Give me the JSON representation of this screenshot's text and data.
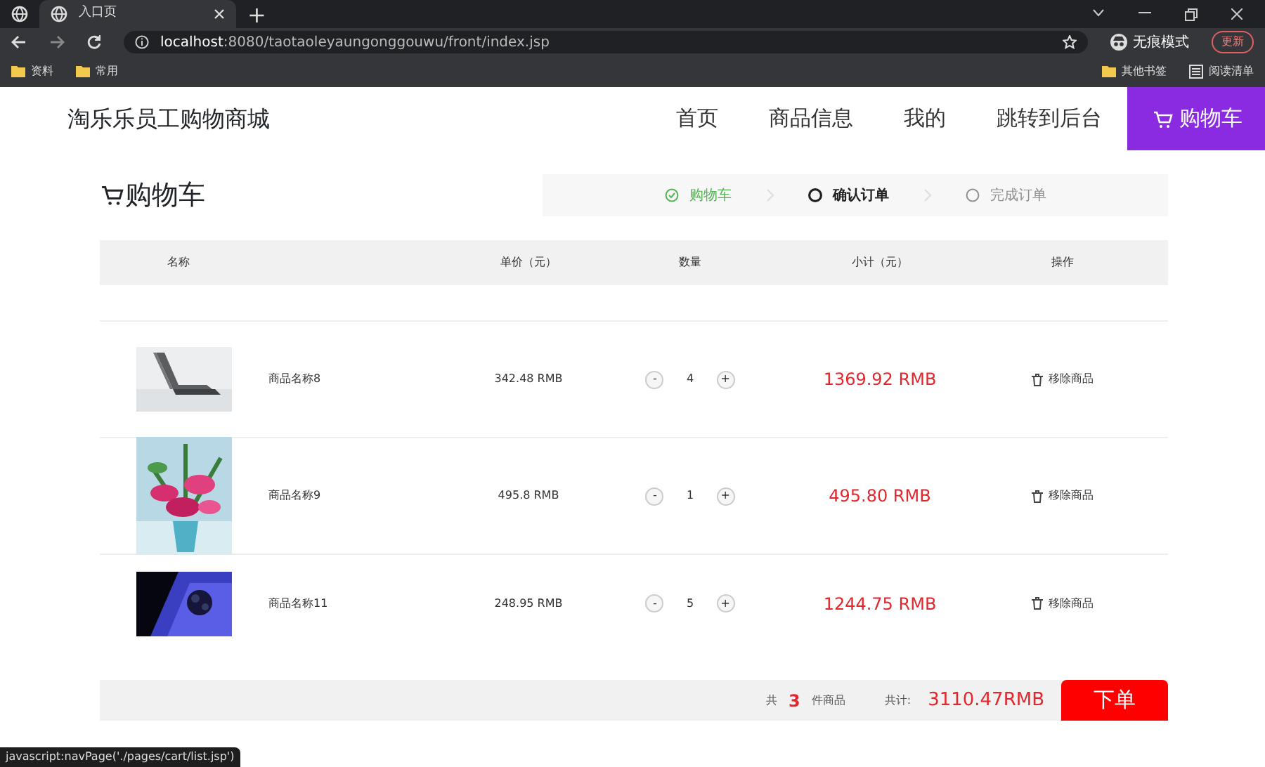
{
  "browser": {
    "tabs": [
      {
        "title": "入口页",
        "selected": true
      }
    ],
    "new_tab": "+",
    "address": {
      "host": "localhost",
      "path": ":8080/taotaoleyaungonggouwu/front/index.jsp"
    },
    "profile": "无痕模式",
    "update_button": "更新",
    "bookmarks": [
      {
        "label": "资料"
      },
      {
        "label": "常用"
      }
    ],
    "bookmarks_right": [
      {
        "label": "其他书签",
        "kind": "folder"
      },
      {
        "label": "阅读清单",
        "kind": "list"
      }
    ]
  },
  "site": {
    "brand": "淘乐乐员工购物商城",
    "nav": [
      {
        "label": "首页",
        "selected": false
      },
      {
        "label": "商品信息",
        "selected": false
      },
      {
        "label": "我的",
        "selected": false
      },
      {
        "label": "跳转到后台",
        "selected": false
      },
      {
        "label": "购物车",
        "selected": true
      }
    ]
  },
  "page_title": "购物车",
  "steps": [
    {
      "label": "购物车",
      "completed": true,
      "selected": false
    },
    {
      "label": "确认订单",
      "completed": false,
      "selected": true
    },
    {
      "label": "完成订单",
      "completed": false,
      "selected": false
    }
  ],
  "table": {
    "columns": [
      "名称",
      "单价（元）",
      "数量",
      "小计（元）",
      "操作"
    ],
    "rows": [
      {
        "kind": "picture",
        "name": "商品名称8",
        "price": "342.48 RMB",
        "minus": "-",
        "qty": "4",
        "plus": "+",
        "subtotal": "1369.92 RMB",
        "action": "移除商品"
      },
      {
        "kind": "picture",
        "name": "商品名称9",
        "price": "495.8 RMB",
        "minus": "-",
        "qty": "1",
        "plus": "+",
        "subtotal": "495.80 RMB",
        "action": "移除商品"
      },
      {
        "kind": "picture",
        "name": "商品名称11",
        "price": "248.95 RMB",
        "minus": "-",
        "qty": "5",
        "plus": "+",
        "subtotal": "1244.75 RMB",
        "action": "移除商品"
      }
    ]
  },
  "summary": {
    "count_prefix": "共",
    "count": "3",
    "count_suffix": "件商品",
    "total_label": "共计:",
    "total": "3110.47RMB",
    "order_button": "下单"
  },
  "status_url": "javascript:navPage('./pages/cart/list.jsp')"
}
